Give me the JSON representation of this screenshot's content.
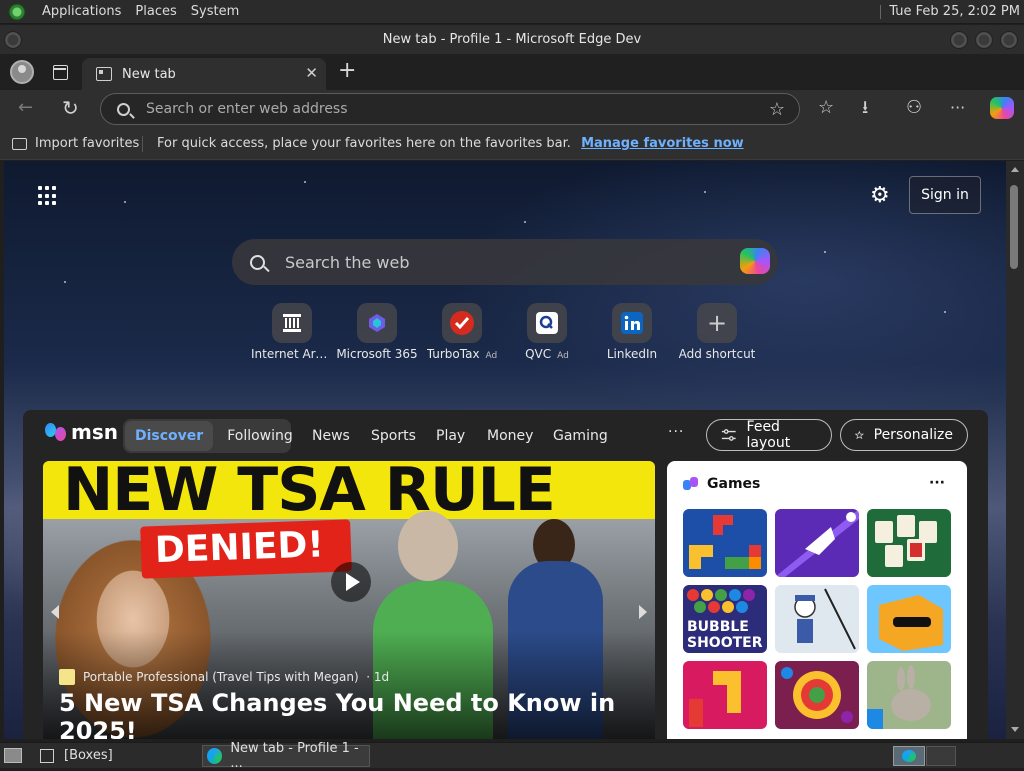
{
  "top_panel": {
    "menus": [
      "Applications",
      "Places",
      "System"
    ],
    "clock": "Tue Feb 25,  2:02 PM"
  },
  "window": {
    "title": "New tab - Profile 1 - Microsoft Edge Dev"
  },
  "tabs": {
    "active_tab": {
      "label": "New tab",
      "close": "✕"
    },
    "new_tab": "+"
  },
  "toolbar": {
    "back": "←",
    "refresh": "↻",
    "address_placeholder": "Search or enter web address",
    "favorite_star": "☆",
    "favorites": "☆",
    "downloads": "⭳",
    "extensions": "⚇",
    "more": "···"
  },
  "favorites_bar": {
    "import_label": "Import favorites",
    "message": "For quick access, place your favorites here on the favorites bar.",
    "link": "Manage favorites now"
  },
  "new_tab_page": {
    "sign_in": "Sign in",
    "settings_icon": "⚙",
    "search_placeholder": "Search the web",
    "shortcuts": [
      {
        "label": "Internet Arc...",
        "ad": ""
      },
      {
        "label": "Microsoft 365",
        "ad": ""
      },
      {
        "label": "TurboTax",
        "ad": "Ad"
      },
      {
        "label": "QVC",
        "ad": "Ad"
      },
      {
        "label": "LinkedIn",
        "ad": ""
      },
      {
        "label": "Add shortcut",
        "ad": ""
      }
    ]
  },
  "feed": {
    "logo": "msn",
    "tabs": [
      "Discover",
      "Following"
    ],
    "nav": [
      "News",
      "Sports",
      "Play",
      "Money",
      "Gaming"
    ],
    "more": "···",
    "feed_layout": "Feed layout",
    "personalize": "Personalize",
    "hero": {
      "image_headline": "NEW TSA RULE",
      "image_badge": "DENIED!",
      "source": "Portable Professional (Travel Tips with Megan)",
      "age": "· 1d",
      "title": "5 New TSA Changes You Need to Know in 2025!"
    },
    "games": {
      "header": "Games",
      "more": "···",
      "tiles": [
        "Block puzzle",
        "Paper.io style",
        "Mahjong",
        "Bubble Shooter HD",
        "Thief puzzle",
        "Cool cube",
        "Block blast",
        "Gem match",
        "Jigsaw bunny"
      ],
      "bubble_text": "BUBBLE SHOOTER"
    }
  },
  "taskbar": {
    "boxes": "[Boxes]",
    "window": "New tab - Profile 1 - ..."
  }
}
